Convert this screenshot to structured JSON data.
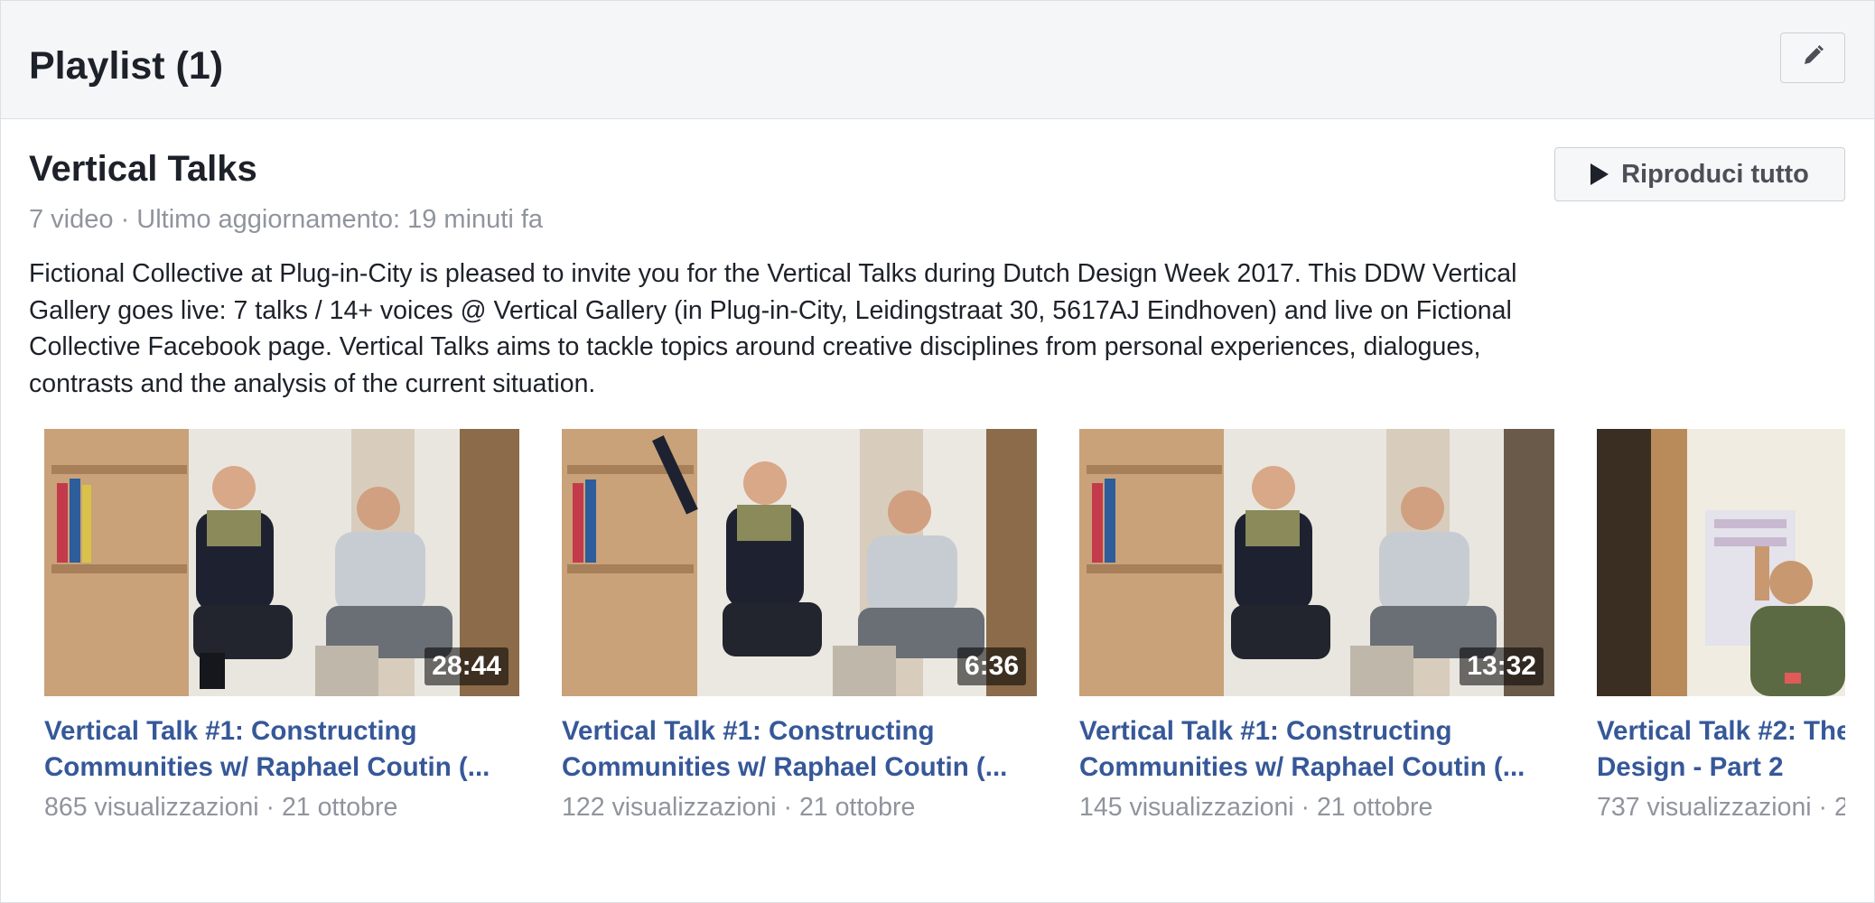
{
  "header": {
    "title": "Playlist (1)"
  },
  "playlist": {
    "title": "Vertical Talks",
    "meta": "7 video · Ultimo aggiornamento: 19 minuti fa",
    "play_all_label": "Riproduci tutto",
    "description": "Fictional Collective at Plug-in-City is pleased to invite you for the Vertical Talks during Dutch Design Week 2017. This DDW Vertical Gallery goes live: 7 talks / 14+ voices @ Vertical Gallery (in Plug-in-City, Leidingstraat 30, 5617AJ Eindhoven) and live on Fictional Collective Facebook page. Vertical Talks aims to tackle topics around creative disciplines from personal experiences, dialogues, contrasts and the analysis of the current situation."
  },
  "videos": [
    {
      "title_line1": "Vertical Talk #1: Constructing",
      "title_line2": "Communities w/ Raphael Coutin (...",
      "meta": "865 visualizzazioni · 21 ottobre",
      "duration": "28:44"
    },
    {
      "title_line1": "Vertical Talk #1: Constructing",
      "title_line2": "Communities w/ Raphael Coutin (...",
      "meta": "122 visualizzazioni · 21 ottobre",
      "duration": "6:36"
    },
    {
      "title_line1": "Vertical Talk #1: Constructing",
      "title_line2": "Communities w/ Raphael Coutin (...",
      "meta": "145 visualizzazioni · 21 ottobre",
      "duration": "13:32"
    },
    {
      "title_line1": "Vertical Talk #2: The",
      "title_line2": "Design - Part 2",
      "meta": "737 visualizzazioni · 2",
      "duration": ""
    }
  ],
  "icons": {
    "edit": "pencil-icon",
    "play": "play-icon"
  },
  "colors": {
    "link": "#365899",
    "meta": "#90949c",
    "text": "#1d2129",
    "header_bg": "#f5f6f7"
  }
}
